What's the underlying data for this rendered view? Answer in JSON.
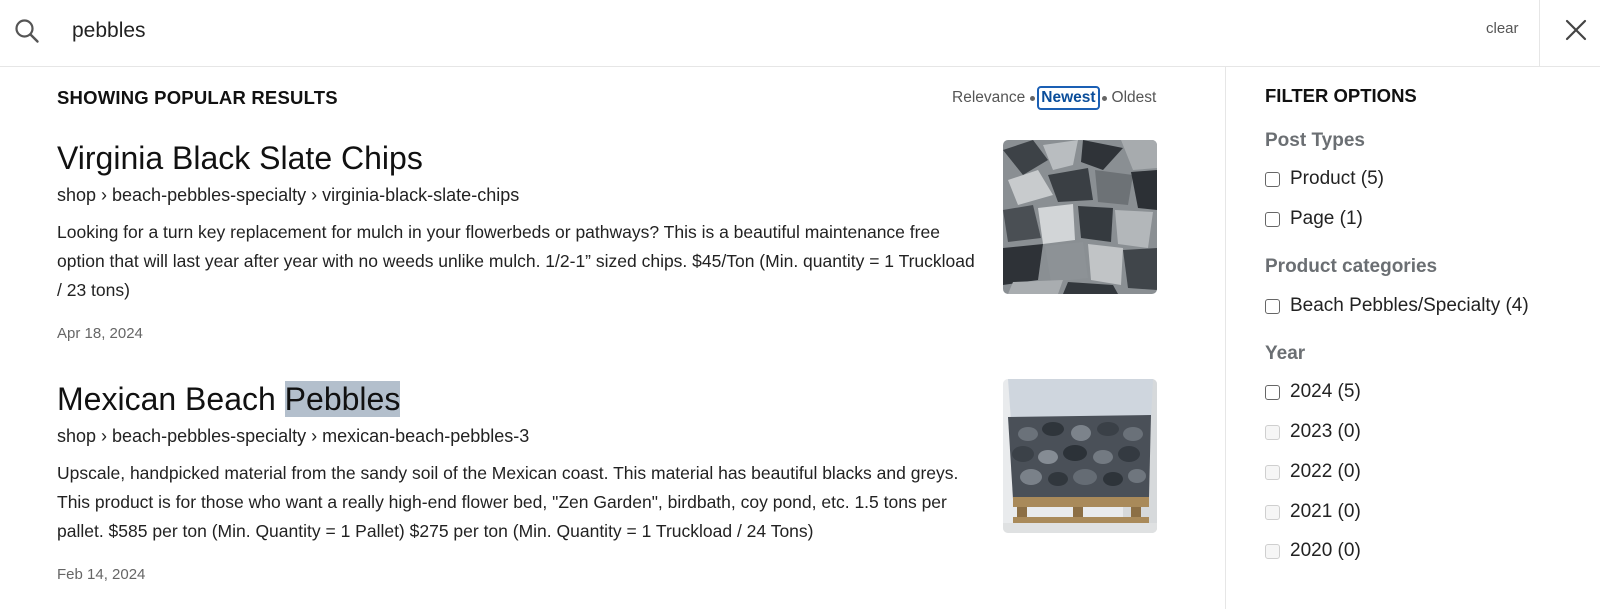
{
  "search": {
    "value": "pebbles",
    "clear_label": "clear"
  },
  "results": {
    "heading": "SHOWING POPULAR RESULTS",
    "sort": {
      "options": [
        "Relevance",
        "Newest",
        "Oldest"
      ],
      "selected": "Newest"
    },
    "items": [
      {
        "title": "Virginia Black Slate Chips",
        "title_highlight": "",
        "path": "shop › beach-pebbles-specialty › virginia-black-slate-chips",
        "description": "Looking for a turn key replacement for mulch in your flowerbeds or pathways? This is a beautiful maintenance free option that will last year after year with no weeds unlike mulch. 1/2-1” sized chips. $45/Ton (Min. quantity = 1 Truckload / 23 tons)",
        "date": "Apr 18, 2024",
        "image": "slate-chips-photo"
      },
      {
        "title_prefix": "Mexican Beach ",
        "title_highlight": "Pebbles",
        "path": "shop › beach-pebbles-specialty › mexican-beach-pebbles-3",
        "description": "Upscale, handpicked material from the sandy soil of the Mexican coast. This material has beautiful blacks and greys. This product is for those who want a really high-end flower bed, \"Zen Garden\", birdbath, coy pond, etc. 1.5 tons per pallet. $585 per ton (Min. Quantity = 1 Pallet) $275 per ton (Min. Quantity = 1 Truckload / 24 Tons)",
        "date": "Feb 14, 2024",
        "image": "beach-pebbles-pallet-photo"
      }
    ]
  },
  "filters": {
    "heading": "FILTER OPTIONS",
    "groups": [
      {
        "title": "Post Types",
        "options": [
          {
            "label": "Product (5)",
            "enabled": true
          },
          {
            "label": "Page (1)",
            "enabled": true
          }
        ]
      },
      {
        "title": "Product categories",
        "options": [
          {
            "label": "Beach Pebbles/Specialty (4)",
            "enabled": true
          }
        ]
      },
      {
        "title": "Year",
        "options": [
          {
            "label": "2024 (5)",
            "enabled": true
          },
          {
            "label": "2023 (0)",
            "enabled": false
          },
          {
            "label": "2022 (0)",
            "enabled": false
          },
          {
            "label": "2021 (0)",
            "enabled": false
          },
          {
            "label": "2020 (0)",
            "enabled": false
          }
        ]
      }
    ]
  },
  "colors": {
    "accent": "#1a5fb4",
    "highlight": "#b3bfcc"
  }
}
